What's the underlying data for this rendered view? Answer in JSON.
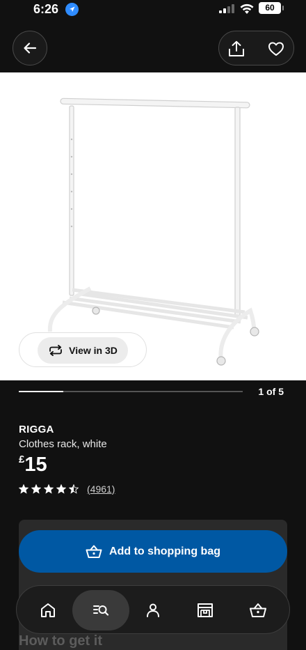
{
  "status_bar": {
    "time": "6:26",
    "battery": "60"
  },
  "nav": {
    "back_icon": "arrow-left-icon",
    "share_icon": "share-icon",
    "favorite_icon": "heart-icon"
  },
  "gallery": {
    "view_3d_label": "View in 3D",
    "page_indicator": "1 of 5",
    "current_page": 1,
    "total_pages": 5
  },
  "product": {
    "name": "RIGGA",
    "description": "Clothes rack, white",
    "currency": "£",
    "price": "15",
    "rating": 4.5,
    "rating_max": 5,
    "review_count": "(4961)"
  },
  "purchase": {
    "add_to_bag_label": "Add to shopping bag",
    "how_to_get_label": "How to get it"
  },
  "tab_bar": {
    "items": [
      {
        "icon": "home-icon"
      },
      {
        "icon": "search-list-icon",
        "active": true
      },
      {
        "icon": "profile-icon"
      },
      {
        "icon": "store-icon"
      },
      {
        "icon": "shopping-bag-icon"
      }
    ]
  },
  "colors": {
    "background": "#111111",
    "primary_button": "#0058a3",
    "image_background": "#ffffff"
  }
}
